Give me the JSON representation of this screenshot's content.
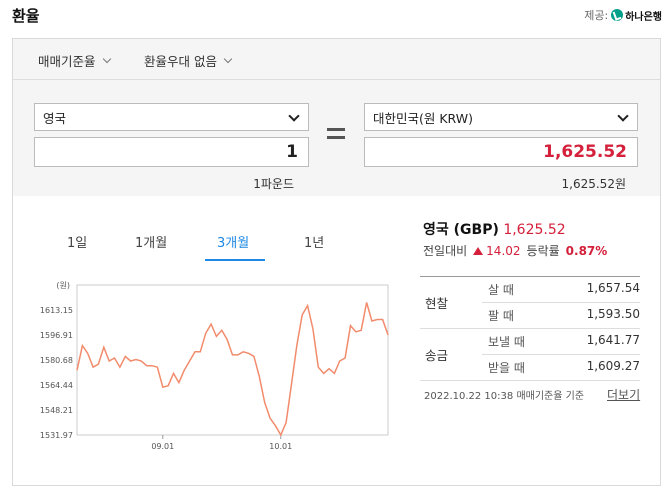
{
  "page_title": "환율",
  "provider": {
    "label": "제공:",
    "name": "하나은행"
  },
  "options": {
    "standard": "매매기준율",
    "preferential": "환율우대 없음"
  },
  "from": {
    "currency": "영국",
    "amount": "1",
    "unit": "1파운드"
  },
  "to": {
    "currency": "대한민국(원 KRW)",
    "amount": "1,625.52",
    "unit": "1,625.52원"
  },
  "tabs": [
    "1일",
    "1개월",
    "3개월",
    "1년"
  ],
  "active_tab": "3개월",
  "summary": {
    "name": "영국 (GBP)",
    "rate": "1,625.52",
    "change_label": "전일대비",
    "change": "14.02",
    "rate_label": "등락률",
    "change_pct": "0.87%"
  },
  "rates": {
    "cash_label": "현찰",
    "buy_label": "살 때",
    "buy": "1,657.54",
    "sell_label": "팔 때",
    "sell": "1,593.50",
    "wire_label": "송금",
    "send_label": "보낼 때",
    "send": "1,641.77",
    "receive_label": "받을 때",
    "receive": "1,609.27"
  },
  "footer": {
    "timestamp": "2022.10.22 10:38",
    "basis": "매매기준율 기준",
    "more": "더보기"
  },
  "chart_data": {
    "type": "line",
    "ylabel": "(원)",
    "yticks": [
      "1613.15",
      "1596.91",
      "1580.68",
      "1564.44",
      "1548.21",
      "1531.97"
    ],
    "ylim": [
      1531.97,
      1629.39
    ],
    "xticks": [
      "09.01",
      "10.01"
    ],
    "color": "#f28b6b",
    "series": [
      {
        "values": [
          1574,
          1590,
          1585,
          1576,
          1578,
          1589,
          1580,
          1582,
          1576,
          1583,
          1580,
          1581,
          1580,
          1577,
          1577,
          1576,
          1563,
          1564,
          1572,
          1566,
          1574,
          1580,
          1586,
          1586,
          1598,
          1604,
          1596,
          1600,
          1594,
          1584,
          1584,
          1586,
          1585,
          1583,
          1570,
          1553,
          1543,
          1538,
          1532,
          1540,
          1565,
          1590,
          1610,
          1616,
          1601,
          1576,
          1572,
          1575,
          1572,
          1580,
          1582,
          1603,
          1599,
          1600,
          1618,
          1606,
          1607,
          1607,
          1597
        ]
      }
    ]
  }
}
